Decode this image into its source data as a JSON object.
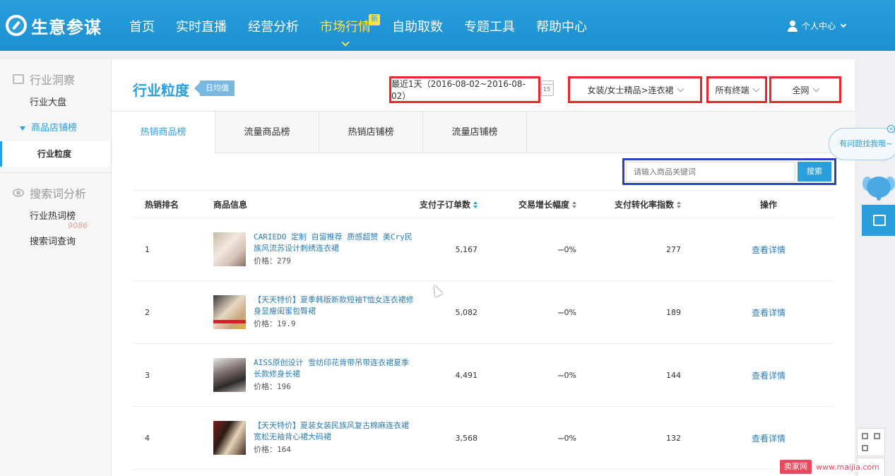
{
  "brand": {
    "name": "生意参谋"
  },
  "nav": {
    "items": [
      {
        "label": "首页"
      },
      {
        "label": "实时直播"
      },
      {
        "label": "经营分析"
      },
      {
        "label": "市场行情",
        "badge": "新"
      },
      {
        "label": "自助取数"
      },
      {
        "label": "专题工具"
      },
      {
        "label": "帮助中心"
      }
    ],
    "active_index": 3,
    "user_label": "个人中心"
  },
  "sidebar": {
    "section1": "行业洞察",
    "item_market": "行业大盘",
    "group_label": "商品店铺榜",
    "active_item": "行业粒度",
    "section2": "搜索词分析",
    "item_hotwords": "行业热词榜",
    "item_query": "搜索词查询"
  },
  "watermark_overlay": "9086",
  "main": {
    "title": "行业粒度",
    "tag": "日均值",
    "date_filter": "最近1天（2016-08-02~2016-08-02）",
    "calendar_number": "15",
    "category_filter": "女装/女士精品>连衣裙",
    "terminal_filter": "所有终端",
    "network_filter": "全网",
    "tabs": [
      "热销商品榜",
      "流量商品榜",
      "热销店铺榜",
      "流量店铺榜"
    ],
    "search": {
      "placeholder": "请输入商品关键词",
      "button": "搜索"
    }
  },
  "table": {
    "headers": {
      "rank": "热销排名",
      "info": "商品信息",
      "orders": "支付子订单数",
      "growth": "交易增长幅度",
      "conversion": "支付转化率指数",
      "operation": "操作"
    },
    "rows": [
      {
        "rank": "1",
        "title": "CARIEDO 定制 自留推荐 质感超赞 美Cry民族风流苏设计刺绣连衣裙",
        "price": "价格：279",
        "orders": "5,167",
        "growth": "0%",
        "conversion": "277",
        "action": "查看详情",
        "thumb": "dress-photo-1"
      },
      {
        "rank": "2",
        "title": "【天天特价】夏季韩版新款短袖T恤女连衣裙修身显瘦闺蜜包臀裙",
        "price": "价格：19.9",
        "orders": "5,082",
        "growth": "0%",
        "conversion": "189",
        "action": "查看详情",
        "thumb": "dress-photo-2"
      },
      {
        "rank": "3",
        "title": "AISS原创设计 雪纺印花背带吊带连衣裙夏季长款修身长裙",
        "price": "价格：196",
        "orders": "4,491",
        "growth": "0%",
        "conversion": "144",
        "action": "查看详情",
        "thumb": "dress-photo-3"
      },
      {
        "rank": "4",
        "title": "【天天特价】夏装女装民族风复古棉麻连衣裙宽松无袖背心裙大码裙",
        "price": "价格：164",
        "orders": "3,568",
        "growth": "0%",
        "conversion": "132",
        "action": "查看详情",
        "thumb": "dress-photo-4"
      }
    ]
  },
  "widgets": {
    "help_bubble": "有问题找我哦~",
    "close_glyph": "×"
  },
  "site_watermark": {
    "logo": "卖家网",
    "url": "www.maijia.com"
  },
  "colors": {
    "brand_blue": "#2a9fdc",
    "active_nav": "#ffe24a",
    "highlight_red": "#e8262b",
    "highlight_blue": "#2b3fc8",
    "link_blue": "#2a7db8"
  }
}
